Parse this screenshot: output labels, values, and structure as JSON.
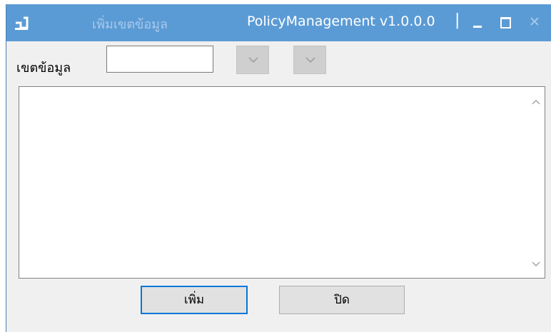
{
  "window": {
    "title_left": "เพิ่มเขตข้อมูล",
    "title_right": "PolicyManagement v1.0.0.0",
    "title_separator": "|",
    "title_bar_color": "#5b9bd5",
    "minimize_icon": "minimize-icon",
    "maximize_icon": "maximize-icon",
    "close_icon": "close-icon",
    "close_glyph": "✕"
  },
  "form": {
    "field_label": "เขตข้อมูล",
    "field_value": "",
    "dropdown1_value": "",
    "dropdown2_value": ""
  },
  "list": {
    "items": []
  },
  "buttons": {
    "add_label": "เพิ่ม",
    "close_label": "ปิด",
    "focus_color": "#0078d7"
  }
}
